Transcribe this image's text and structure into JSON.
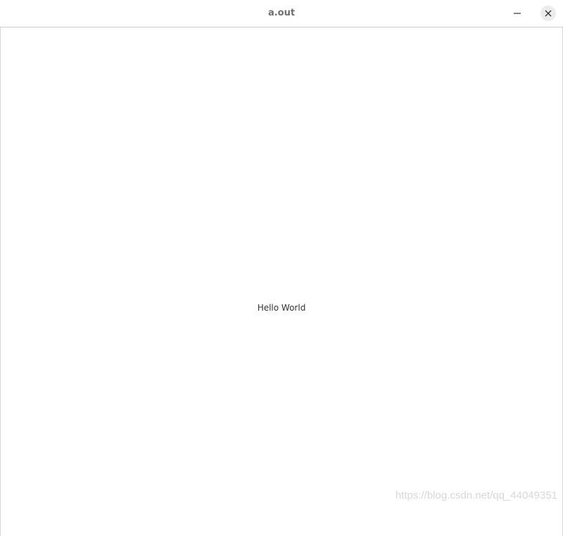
{
  "window": {
    "title": "a.out"
  },
  "content": {
    "label": "Hello World"
  },
  "watermark": {
    "text": "https://blog.csdn.net/qq_44049351"
  },
  "icons": {
    "minimize": "minimize-icon",
    "close": "close-icon"
  },
  "colors": {
    "title_text": "#6b6f73",
    "close_button_bg": "#ececec",
    "label_text": "#2e3436"
  }
}
